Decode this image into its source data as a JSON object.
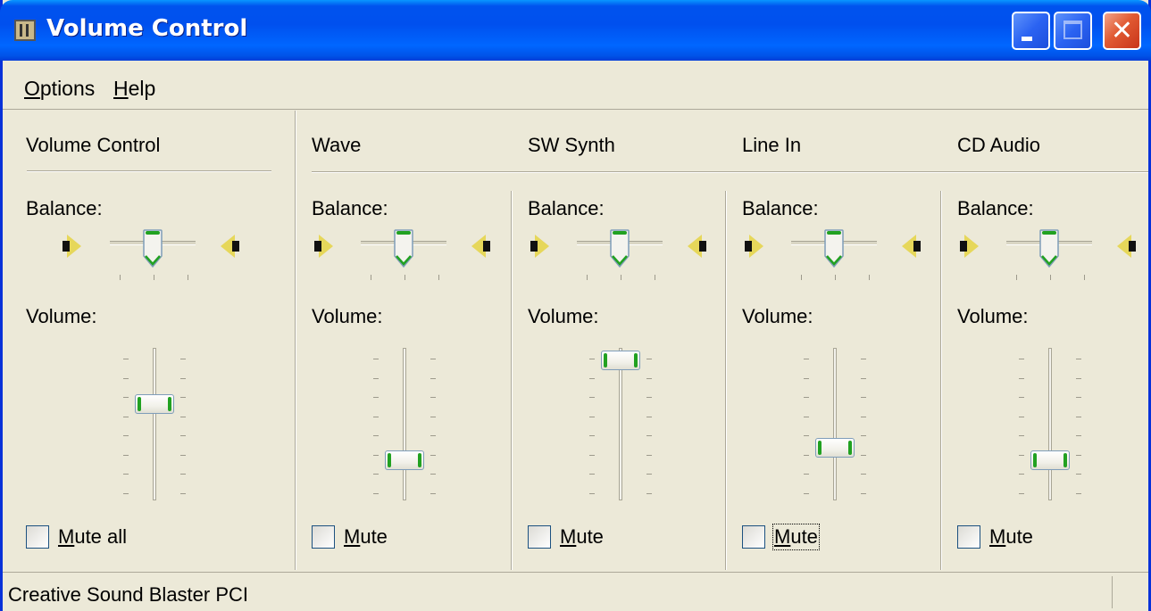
{
  "window": {
    "title": "Volume Control",
    "accent": "#0053ee",
    "close_color": "#e15a32",
    "buttons": {
      "minimize_icon": "minimize-icon",
      "maximize_icon": "maximize-icon",
      "close_icon": "close-icon"
    }
  },
  "menu": {
    "options": {
      "mnemonic": "O",
      "rest": "ptions"
    },
    "help": {
      "mnemonic": "H",
      "rest": "elp"
    }
  },
  "labels": {
    "balance": "Balance:",
    "volume": "Volume:"
  },
  "channels": [
    {
      "name": "Volume Control",
      "balance": 0.5,
      "volume": 0.65,
      "mute_mnemonic": "M",
      "mute_rest": "ute all",
      "muted": false
    },
    {
      "name": "Wave",
      "balance": 0.5,
      "volume": 0.2,
      "mute_mnemonic": "M",
      "mute_rest": "ute",
      "muted": false
    },
    {
      "name": "SW Synth",
      "balance": 0.5,
      "volume": 1.0,
      "mute_mnemonic": "M",
      "mute_rest": "ute",
      "muted": false
    },
    {
      "name": "Line In",
      "balance": 0.5,
      "volume": 0.3,
      "mute_mnemonic": "M",
      "mute_rest": "ute",
      "muted": false
    },
    {
      "name": "CD Audio",
      "balance": 0.5,
      "volume": 0.2,
      "mute_mnemonic": "M",
      "mute_rest": "ute",
      "muted": false
    }
  ],
  "icons": {
    "speaker_left": "speaker-left-icon",
    "speaker_right": "speaker-right-icon"
  },
  "status": {
    "text": "Creative Sound Blaster PCI"
  }
}
